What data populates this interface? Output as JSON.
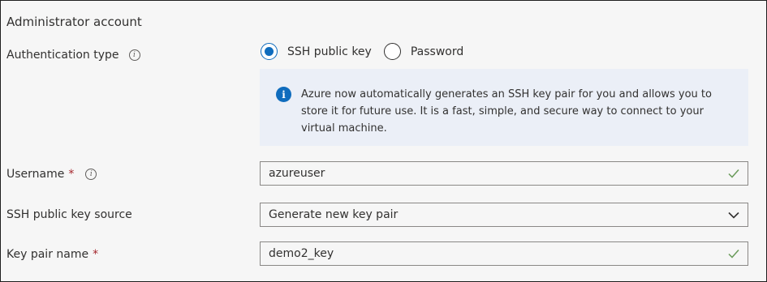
{
  "section": {
    "title": "Administrator account"
  },
  "auth": {
    "label": "Authentication type",
    "options": [
      {
        "label": "SSH public key",
        "selected": true
      },
      {
        "label": "Password",
        "selected": false
      }
    ],
    "info_text": "Azure now automatically generates an SSH key pair for you and allows you to store it for future use. It is a fast, simple, and secure way to connect to your virtual machine."
  },
  "username": {
    "label": "Username",
    "required_mark": "*",
    "value": "azureuser"
  },
  "ssh_source": {
    "label": "SSH public key source",
    "value": "Generate new key pair"
  },
  "key_pair": {
    "label": "Key pair name",
    "required_mark": "*",
    "value": "demo2_key"
  },
  "colors": {
    "accent": "#0f6cbd",
    "valid_check": "#6a9b5a",
    "info_bg": "#ebeff7",
    "required": "#a4262c"
  }
}
